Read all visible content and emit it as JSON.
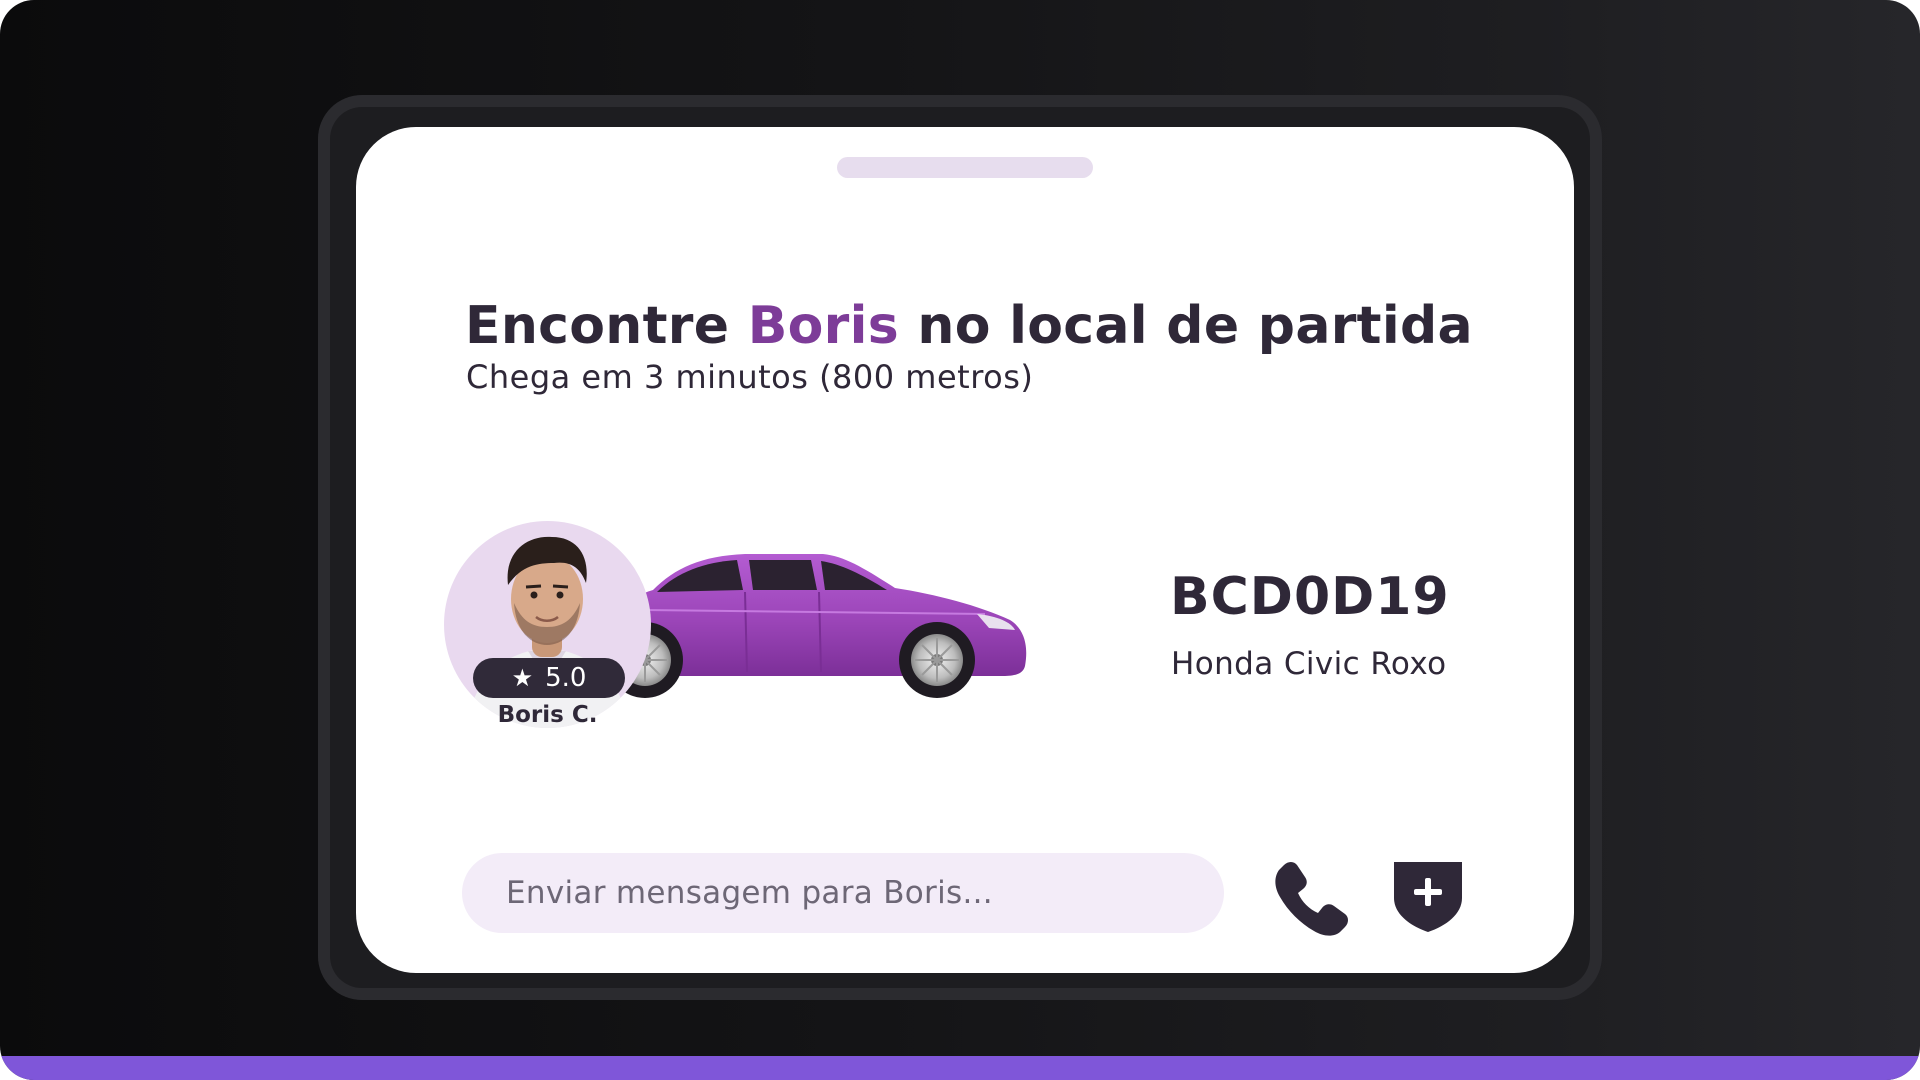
{
  "header": {
    "title_prefix": "Encontre ",
    "title_name": "Boris",
    "title_suffix": " no local de partida",
    "subtitle": "Chega em 3 minutos (800 metros)"
  },
  "driver": {
    "name": "Boris C.",
    "rating": "5.0"
  },
  "vehicle": {
    "plate": "BCD0D19",
    "model": "Honda Civic Roxo",
    "color": "#9b45b8"
  },
  "message": {
    "placeholder": "Enviar mensagem para Boris...",
    "value": ""
  },
  "actions": {
    "call_icon": "phone-icon",
    "safety_icon": "shield-plus-icon"
  },
  "colors": {
    "accent": "#7d3c98",
    "text": "#2f2838",
    "bottom_bar": "#7f56d9",
    "input_bg": "#f3ecf8"
  }
}
